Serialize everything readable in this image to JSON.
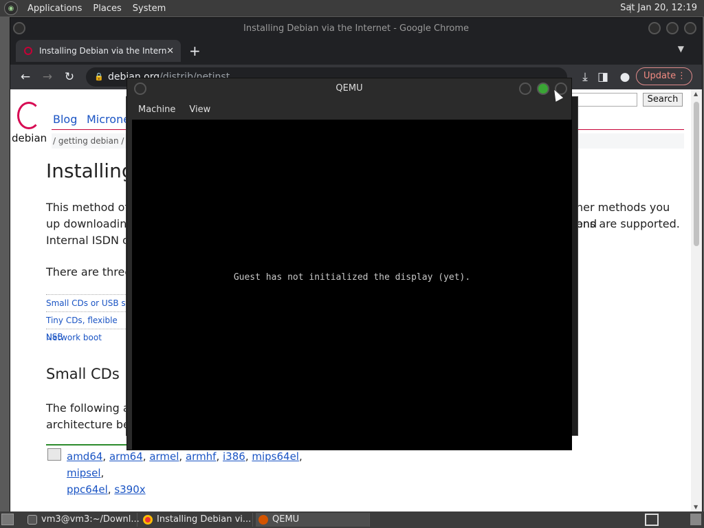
{
  "top_panel": {
    "menus": [
      "Applications",
      "Places",
      "System"
    ],
    "clock": "Sat Jan 20, 12:19"
  },
  "chrome": {
    "window_title": "Installing Debian via the Internet - Google Chrome",
    "tab_title": "Installing Debian via the Intern",
    "url_host": "debian.org",
    "url_path": "/distrib/netinst",
    "update_label": "Update"
  },
  "page": {
    "logo_text": "debian",
    "nav": [
      "Blog",
      "Microne"
    ],
    "breadcrumb": "/  getting debian / ins",
    "search_button": "Search",
    "heading": "Installing",
    "para1_left_a": "This method of i",
    "para1_right_a": "her methods you end",
    "para1_left_b": "up downloading",
    "para1_right_b": "ons are supported.",
    "para1_left_c": "Internal ISDN ca",
    "para2": "There are three",
    "toc": [
      "Small CDs or USB sti",
      "Tiny CDs, flexible USB",
      "Network boot"
    ],
    "heading2": "Small CDs",
    "para3_a": "The following are",
    "para3_b": "architecture belo",
    "architectures": [
      "amd64",
      "arm64",
      "armel",
      "armhf",
      "i386",
      "mips64el",
      "mipsel",
      "ppc64el",
      "s390x"
    ]
  },
  "qemu": {
    "title": "QEMU",
    "menu": [
      "Machine",
      "View"
    ],
    "message": "Guest has not initialized the display (yet)."
  },
  "taskbar": {
    "tasks": [
      "vm3@vm3:~/Downl...",
      "Installing Debian vi...",
      "QEMU"
    ]
  },
  "colors": {
    "debian_red": "#c70036",
    "link_blue": "#1a54c4",
    "qemu_green": "#3aa535"
  }
}
